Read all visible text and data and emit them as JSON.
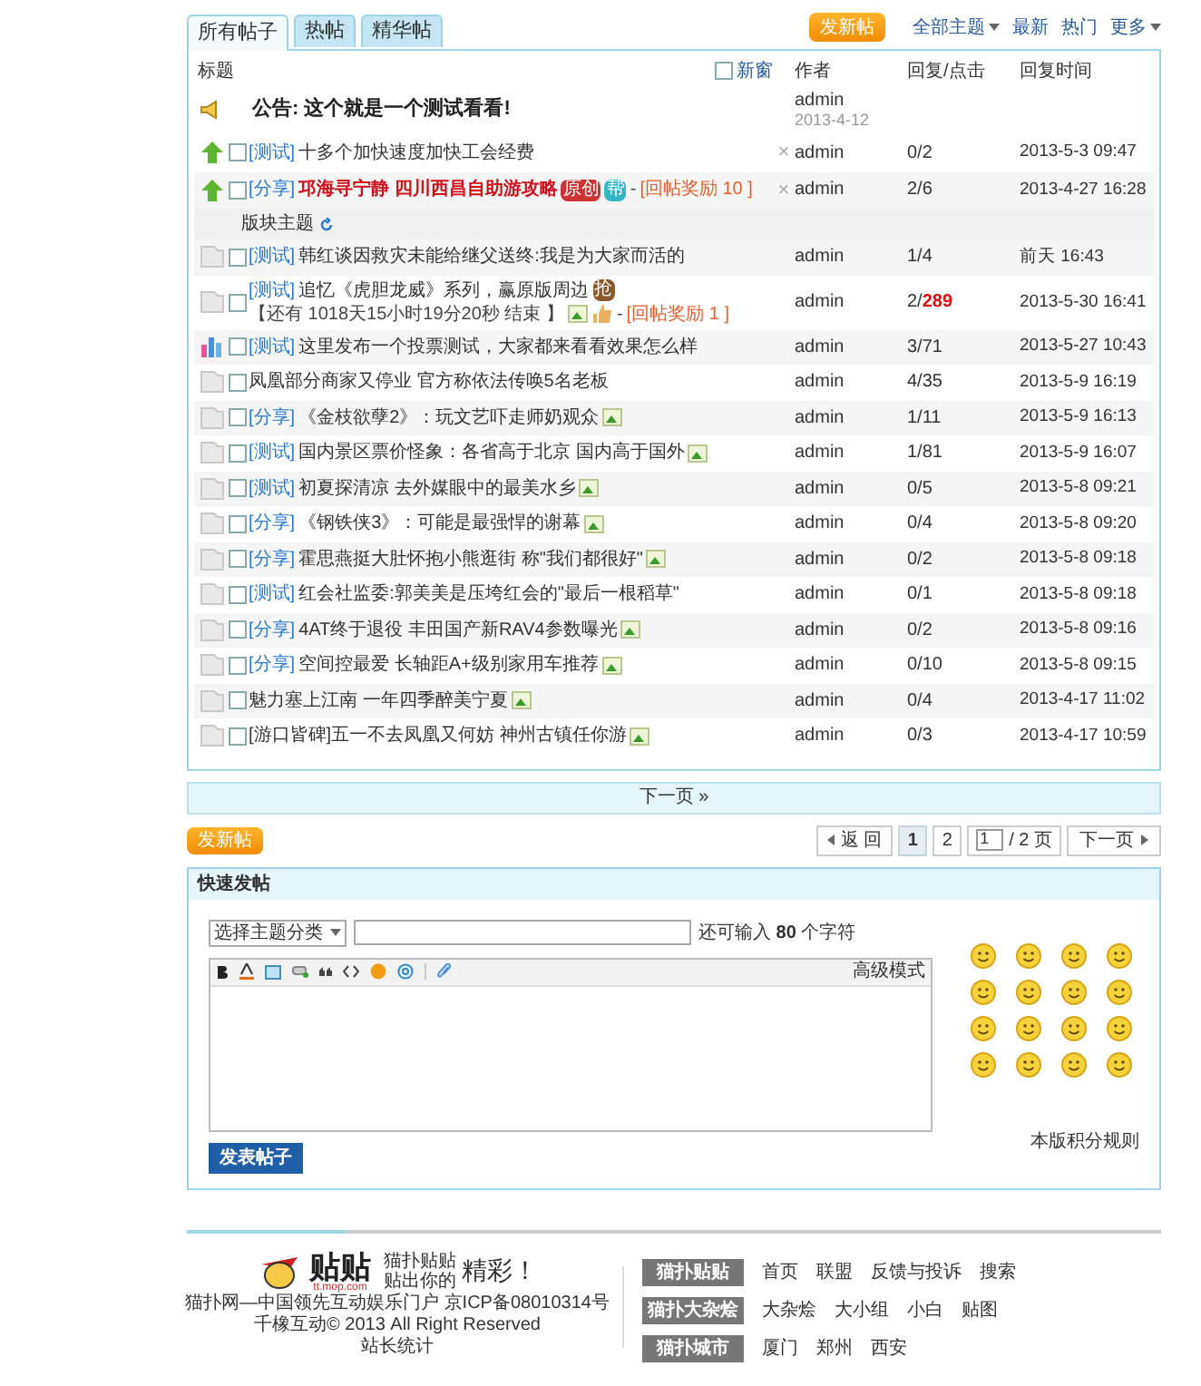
{
  "tabs": [
    {
      "label": "所有帖子",
      "selected": true
    },
    {
      "label": "热帖",
      "selected": false
    },
    {
      "label": "精华帖",
      "selected": false
    }
  ],
  "toolbar": {
    "new_post": "发新帖",
    "filter": "全部主题",
    "links": [
      "最新",
      "热门"
    ],
    "more": "更多"
  },
  "table": {
    "columns": {
      "title": "标题",
      "new_window": "新窗",
      "new_window_checked": false,
      "author": "作者",
      "stats": "回复/点击",
      "time": "回复时间"
    },
    "rows": [
      {
        "kind": "announcement",
        "title": "公告: 这个就是一个测试看看!",
        "author": "admin",
        "date": "2013-4-12"
      },
      {
        "kind": "sticky",
        "checked": false,
        "tag": "[测试]",
        "title": "十多个加快速度加快工会经费",
        "highlight": false,
        "close": "×",
        "author": "admin",
        "stats": "0/2",
        "time": "2013-5-3 09:47"
      },
      {
        "kind": "sticky",
        "checked": false,
        "tag": "[分享]",
        "title": "邛海寻宁静 四川西昌自助游攻略",
        "highlight": true,
        "extras": [
          {
            "kind": "badge",
            "text": "原创",
            "color": "#cc3333"
          },
          {
            "kind": "badge",
            "text": "帮",
            "color": "#33b5c8"
          },
          {
            "kind": "text",
            "text": "-"
          },
          {
            "kind": "reward",
            "text": "[回帖奖励 10 ]"
          }
        ],
        "close": "×",
        "author": "admin",
        "stats": "2/6",
        "time": "2013-4-27 16:28"
      },
      {
        "kind": "section",
        "title": "版块主题"
      },
      {
        "kind": "normal",
        "checked": false,
        "tag": "[测试]",
        "title": "韩红谈因救灾未能给继父送终:我是为大家而活的",
        "highlight": false,
        "author": "admin",
        "stats": "1/4",
        "time": "前天 16:43"
      },
      {
        "kind": "normal",
        "checked": false,
        "tag": "[测试]",
        "title": "追忆《虎胆龙威》系列，赢原版周边",
        "highlight": false,
        "extras": [
          {
            "kind": "badge",
            "text": "抢",
            "color": "#8b5a2b"
          },
          {
            "kind": "text",
            "text": "【还有 1018天15小时19分20秒 结束 】"
          },
          {
            "kind": "image"
          },
          {
            "kind": "thumb"
          },
          {
            "kind": "text",
            "text": "-"
          },
          {
            "kind": "reward",
            "text": "[回帖奖励 1 ]"
          }
        ],
        "author": "admin",
        "stats": "2/**289**",
        "time": "2013-5-30 16:41"
      },
      {
        "kind": "poll",
        "checked": false,
        "tag": "[测试]",
        "title": "这里发布一个投票测试，大家都来看看效果怎么样",
        "highlight": false,
        "author": "admin",
        "stats": "3/71",
        "time": "2013-5-27 10:43"
      },
      {
        "kind": "normal",
        "checked": false,
        "title": "凤凰部分商家又停业 官方称依法传唤5名老板",
        "highlight": false,
        "author": "admin",
        "stats": "4/35",
        "time": "2013-5-9 16:19"
      },
      {
        "kind": "normal",
        "checked": false,
        "tag": "[分享]",
        "title": "《金枝欲孽2》：玩文艺吓走师奶观众",
        "highlight": false,
        "extras": [
          {
            "kind": "image"
          }
        ],
        "author": "admin",
        "stats": "1/11",
        "time": "2013-5-9 16:13"
      },
      {
        "kind": "normal",
        "checked": false,
        "tag": "[测试]",
        "title": "国内景区票价怪象：各省高于北京 国内高于国外",
        "highlight": false,
        "extras": [
          {
            "kind": "image"
          }
        ],
        "author": "admin",
        "stats": "1/81",
        "time": "2013-5-9 16:07"
      },
      {
        "kind": "normal",
        "checked": false,
        "tag": "[测试]",
        "title": "初夏探清凉 去外媒眼中的最美水乡",
        "highlight": false,
        "extras": [
          {
            "kind": "image"
          }
        ],
        "author": "admin",
        "stats": "0/5",
        "time": "2013-5-8 09:21"
      },
      {
        "kind": "normal",
        "checked": false,
        "tag": "[分享]",
        "title": "《钢铁侠3》：可能是最强悍的谢幕",
        "highlight": false,
        "extras": [
          {
            "kind": "image"
          }
        ],
        "author": "admin",
        "stats": "0/4",
        "time": "2013-5-8 09:20"
      },
      {
        "kind": "normal",
        "checked": false,
        "tag": "[分享]",
        "title": "霍思燕挺大肚怀抱小熊逛街 称\"我们都很好\"",
        "highlight": false,
        "extras": [
          {
            "kind": "image"
          }
        ],
        "author": "admin",
        "stats": "0/2",
        "time": "2013-5-8 09:18"
      },
      {
        "kind": "normal",
        "checked": false,
        "tag": "[测试]",
        "title": "红会社监委:郭美美是压垮红会的\"最后一根稻草\"",
        "highlight": false,
        "author": "admin",
        "stats": "0/1",
        "time": "2013-5-8 09:18"
      },
      {
        "kind": "normal",
        "checked": false,
        "tag": "[分享]",
        "title": "4AT终于退役 丰田国产新RAV4参数曝光",
        "highlight": false,
        "extras": [
          {
            "kind": "image"
          }
        ],
        "author": "admin",
        "stats": "0/2",
        "time": "2013-5-8 09:16"
      },
      {
        "kind": "normal",
        "checked": false,
        "tag": "[分享]",
        "title": "空间控最爱 长轴距A+级别家用车推荐",
        "highlight": false,
        "extras": [
          {
            "kind": "image"
          }
        ],
        "author": "admin",
        "stats": "0/10",
        "time": "2013-5-8 09:15"
      },
      {
        "kind": "normal",
        "checked": false,
        "title": "魅力塞上江南 一年四季醉美宁夏",
        "highlight": false,
        "extras": [
          {
            "kind": "image"
          }
        ],
        "author": "admin",
        "stats": "0/4",
        "time": "2013-4-17 11:02"
      },
      {
        "kind": "normal",
        "checked": false,
        "title": "[游口皆碑]五一不去凤凰又何妨 神州古镇任你游",
        "highlight": false,
        "extras": [
          {
            "kind": "image"
          }
        ],
        "author": "admin",
        "stats": "0/3",
        "time": "2013-4-17 10:59"
      }
    ]
  },
  "next_page_bar": "下一页 »",
  "pager": {
    "new_post": "发新帖",
    "back": "返 回",
    "pages": [
      {
        "label": "1",
        "selected": true
      },
      {
        "label": "2",
        "selected": false
      }
    ],
    "page_input": "1",
    "total": "/ 2 页",
    "next": "下一页"
  },
  "quick_post": {
    "title": "快速发帖",
    "category_select": "选择主题分类",
    "char_hint": "还可输入 **80** 个字符",
    "advanced_mode": "高级模式",
    "submit": "发表帖子",
    "rules_link": "本版积分规则"
  },
  "footer": {
    "logo_name": "贴贴",
    "logo_domain": "tt.mop.com",
    "slogan_1": "猫扑贴贴",
    "slogan_2": "贴出你的",
    "slogan_3": "精彩！",
    "lines": [
      "猫扑网—中国领先互动娱乐门户 京ICP备08010314号",
      "千橡互动© 2013 All Right Reserved",
      "站长统计"
    ],
    "nav": [
      {
        "label": "猫扑贴贴",
        "links": [
          "首页",
          "联盟",
          "反馈与投诉",
          "搜索"
        ]
      },
      {
        "label": "猫扑大杂烩",
        "links": [
          "大杂烩",
          "大小组",
          "小白",
          "贴图"
        ]
      },
      {
        "label": "猫扑城市",
        "links": [
          "厦门",
          "郑州",
          "西安"
        ]
      }
    ]
  }
}
